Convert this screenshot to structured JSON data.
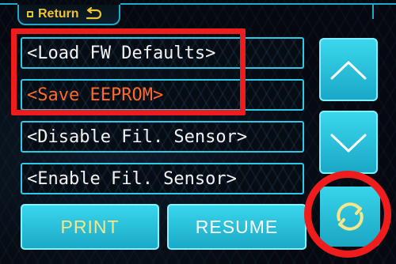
{
  "header": {
    "title": "Return",
    "return_icon": "return-arrow-icon",
    "bullet_icon": "square-bullet-icon"
  },
  "menu": {
    "items": [
      {
        "label": "<Load FW Defaults>",
        "selected": false
      },
      {
        "label": "<Save EEPROM>",
        "selected": true
      },
      {
        "label": "<Disable Fil. Sensor>",
        "selected": false
      },
      {
        "label": "<Enable Fil. Sensor>",
        "selected": false
      }
    ]
  },
  "nav": {
    "up_icon": "chevron-up-icon",
    "down_icon": "chevron-down-icon",
    "refresh_icon": "refresh-icon"
  },
  "bottom": {
    "print_label": "PRINT",
    "resume_label": "RESUME"
  },
  "colors": {
    "accent_cyan": "#2cc9e8",
    "selected_text": "#ff6a2a",
    "title_yellow": "#f1c232",
    "annotation_red": "#ee1c1c"
  }
}
